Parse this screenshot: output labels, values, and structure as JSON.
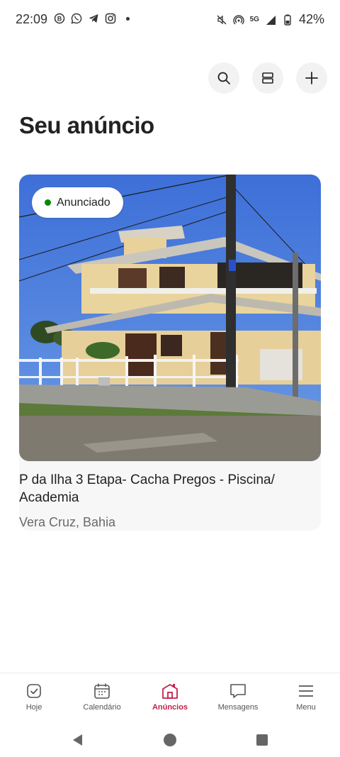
{
  "status_bar": {
    "time": "22:09",
    "left_icons": [
      "b-circle-icon",
      "whatsapp-icon",
      "telegram-icon",
      "instagram-icon"
    ],
    "network": "5G",
    "battery": "42%"
  },
  "header": {
    "title": "Seu anúncio",
    "actions": [
      "search-icon",
      "layout-icon",
      "plus-icon"
    ]
  },
  "listing": {
    "status": "Anunciado",
    "status_color": "#008a05",
    "title": "P da Ilha 3 Etapa- Cacha Pregos - Piscina/ Academia",
    "location": "Vera Cruz, Bahia"
  },
  "bottom_nav": {
    "items": [
      {
        "label": "Hoje",
        "icon": "today-icon"
      },
      {
        "label": "Calendário",
        "icon": "calendar-icon"
      },
      {
        "label": "Anúncios",
        "icon": "house-icon",
        "active": true
      },
      {
        "label": "Mensagens",
        "icon": "message-icon"
      },
      {
        "label": "Menu",
        "icon": "menu-icon"
      }
    ],
    "active_color": "#c4204a"
  }
}
